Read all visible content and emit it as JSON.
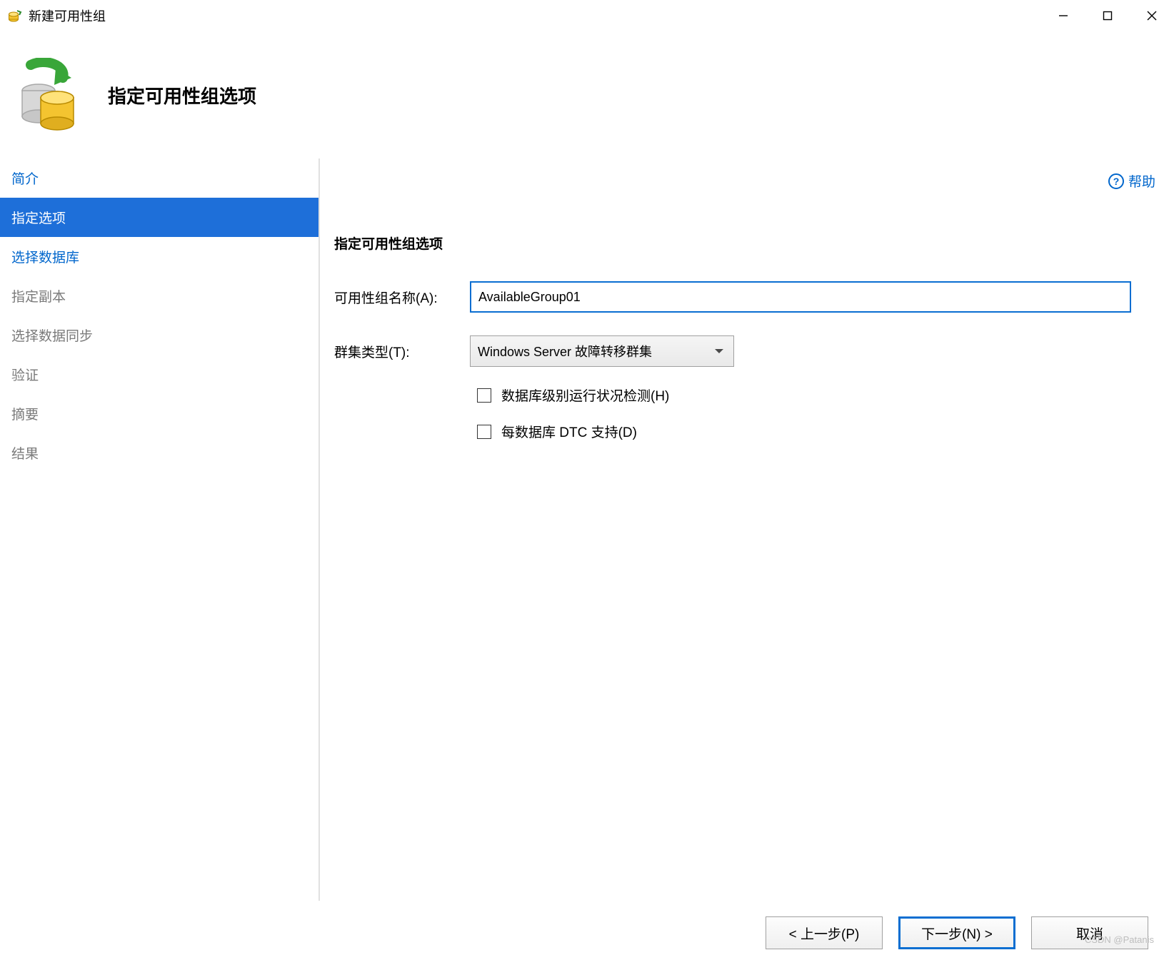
{
  "window": {
    "title": "新建可用性组"
  },
  "header": {
    "title": "指定可用性组选项"
  },
  "help": {
    "label": "帮助"
  },
  "sidebar": {
    "items": [
      {
        "label": "简介",
        "state": "done"
      },
      {
        "label": "指定选项",
        "state": "current"
      },
      {
        "label": "选择数据库",
        "state": "done"
      },
      {
        "label": "指定副本",
        "state": "pending"
      },
      {
        "label": "选择数据同步",
        "state": "pending"
      },
      {
        "label": "验证",
        "state": "pending"
      },
      {
        "label": "摘要",
        "state": "pending"
      },
      {
        "label": "结果",
        "state": "pending"
      }
    ]
  },
  "form": {
    "section_title": "指定可用性组选项",
    "name_label": "可用性组名称(A):",
    "name_value": "AvailableGroup01",
    "cluster_label": "群集类型(T):",
    "cluster_value": "Windows Server 故障转移群集",
    "checkbox_health": "数据库级别运行状况检测(H)",
    "checkbox_dtc": "每数据库 DTC 支持(D)"
  },
  "footer": {
    "prev": "< 上一步(P)",
    "next": "下一步(N) >",
    "cancel": "取消"
  },
  "credit": "CSDN @Patanis"
}
